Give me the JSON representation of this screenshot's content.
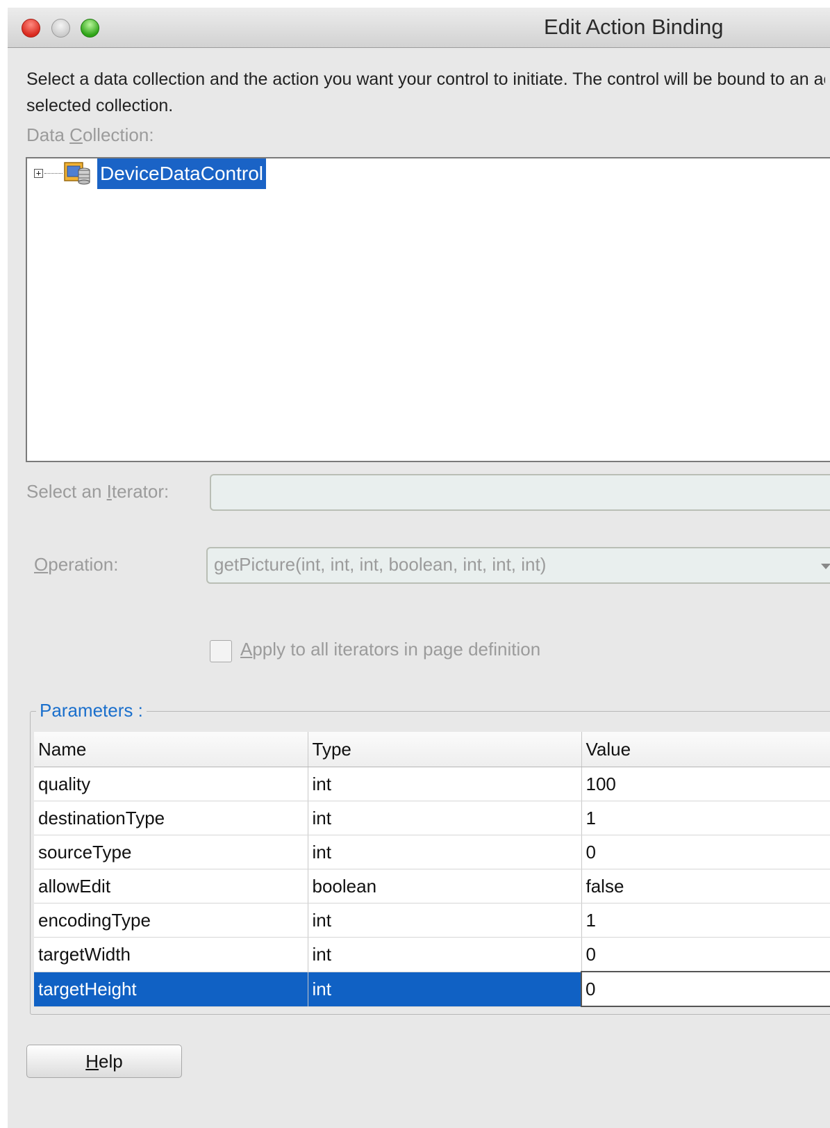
{
  "window": {
    "title": "Edit Action Binding"
  },
  "description": "Select a data collection and the action you want your control to initiate. The control will be bound to an action on the\nselected collection.",
  "data_collection": {
    "label_prefix": "Data ",
    "label_mnemonic": "C",
    "label_suffix": "ollection:",
    "expander_icon": "plus-box-icon",
    "node_icon": "data-control-icon",
    "node_label": "DeviceDataControl"
  },
  "iterator": {
    "label_prefix": "Select an ",
    "label_mnemonic": "I",
    "label_suffix": "terator:",
    "value": ""
  },
  "operation": {
    "label_mnemonic": "O",
    "label_suffix": "peration:",
    "value": "getPicture(int, int, int, boolean, int, int, int)"
  },
  "apply_all": {
    "label_mnemonic": "A",
    "label_suffix": "pply to all iterators in page definition",
    "checked": false
  },
  "parameters": {
    "legend": "Parameters :",
    "columns": [
      "Name",
      "Type",
      "Value"
    ],
    "rows": [
      {
        "name": "quality",
        "type": "int",
        "value": "100"
      },
      {
        "name": "destinationType",
        "type": "int",
        "value": "1"
      },
      {
        "name": "sourceType",
        "type": "int",
        "value": "0"
      },
      {
        "name": "allowEdit",
        "type": "boolean",
        "value": "false"
      },
      {
        "name": "encodingType",
        "type": "int",
        "value": "1"
      },
      {
        "name": "targetWidth",
        "type": "int",
        "value": "0"
      },
      {
        "name": "targetHeight",
        "type": "int",
        "value": "0"
      }
    ],
    "selected_row": "targetHeight"
  },
  "help_button": {
    "label_mnemonic": "H",
    "label_suffix": "elp"
  },
  "colors": {
    "selection": "#1061c4",
    "legend": "#1a6fcc",
    "disabled_text": "#9b9b9b"
  }
}
